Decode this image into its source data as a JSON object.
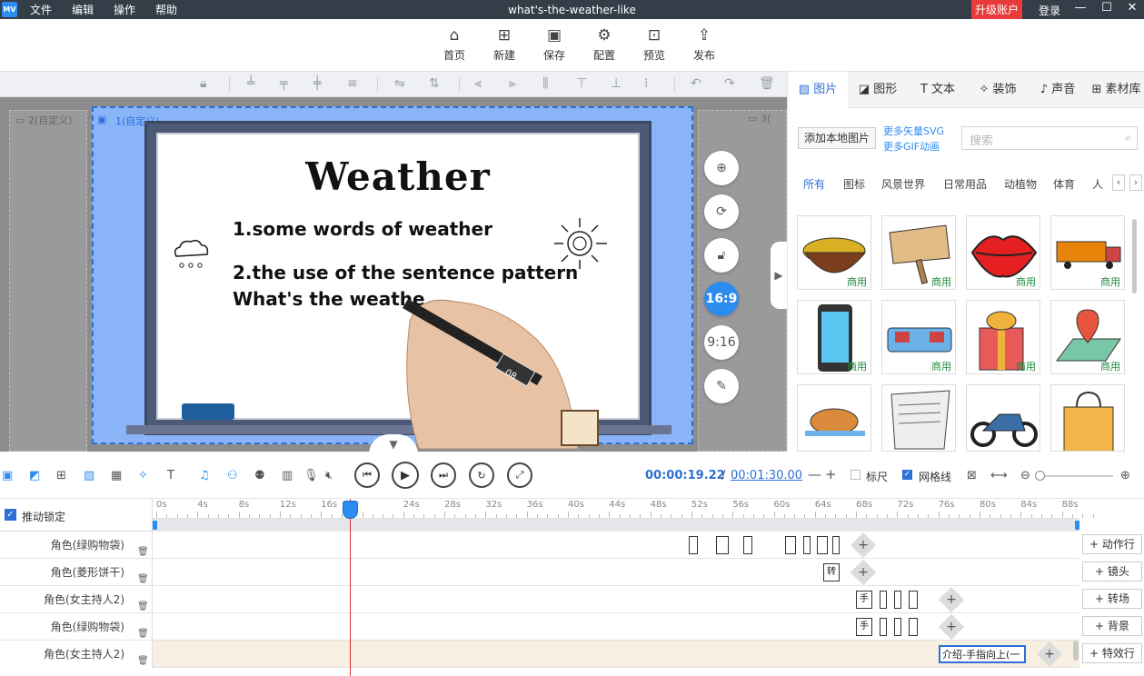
{
  "app": {
    "logo": "MV",
    "title": "what's-the-weather-like",
    "upgrade": "升级账户",
    "login": "登录"
  },
  "menu": [
    "文件",
    "编辑",
    "操作",
    "帮助"
  ],
  "toolbar": [
    {
      "label": "首页",
      "icon": "home-icon"
    },
    {
      "label": "新建",
      "icon": "new-icon"
    },
    {
      "label": "保存",
      "icon": "save-icon"
    },
    {
      "label": "配置",
      "icon": "settings-icon"
    },
    {
      "label": "预览",
      "icon": "preview-icon"
    },
    {
      "label": "发布",
      "icon": "publish-icon"
    }
  ],
  "canvas": {
    "frame_left": "2(自定义)",
    "frame_main": "1(自定义)",
    "frame_right": "3(",
    "title": "Weather",
    "line1": "1.some words of weather",
    "line2": "2.the use of the sentence pattern",
    "line3": "What's the weathe",
    "ratio_active": "16:9",
    "ratio_alt": "9:16",
    "marker_label": "08"
  },
  "rpanel": {
    "tabs": [
      "图片",
      "图形",
      "文本",
      "装饰",
      "声音",
      "素材库"
    ],
    "add_local": "添加本地图片",
    "more_svg": "更多矢量SVG",
    "more_gif": "更多GIF动画",
    "search_placeholder": "搜索",
    "categories": [
      "所有",
      "图标",
      "风景世界",
      "日常用品",
      "动植物",
      "体育",
      "人"
    ],
    "commercial_tag": "商用"
  },
  "controls": {
    "time_current": "00:00:19.22",
    "time_sep": "/",
    "time_total": "00:01:30.00",
    "ruler_label": "标尺",
    "grid_label": "网格线"
  },
  "timeline": {
    "lock_label": "推动锁定",
    "ticks": [
      "0s",
      "4s",
      "8s",
      "12s",
      "16s",
      "",
      "24s",
      "28s",
      "32s",
      "36s",
      "40s",
      "44s",
      "48s",
      "52s",
      "56s",
      "60s",
      "64s",
      "68s",
      "72s",
      "76s",
      "80s",
      "84s",
      "88s"
    ],
    "rows": [
      "角色(绿购物袋)",
      "角色(菱形饼干)",
      "角色(女主持人2)",
      "角色(绿购物袋)",
      "角色(女主持人2)"
    ],
    "row2_seg": "转",
    "row3_seg": "手",
    "row5_seg": "介绍-手指向上(一",
    "add_buttons": [
      "动作行",
      "镜头",
      "转场",
      "背景",
      "特效行"
    ]
  },
  "colors": {
    "accent": "#2d8cf0",
    "upgrade": "#e83a3a",
    "titlebar": "#343e48",
    "scene": "#8ab4f8",
    "commercial": "#1e8a3c"
  }
}
